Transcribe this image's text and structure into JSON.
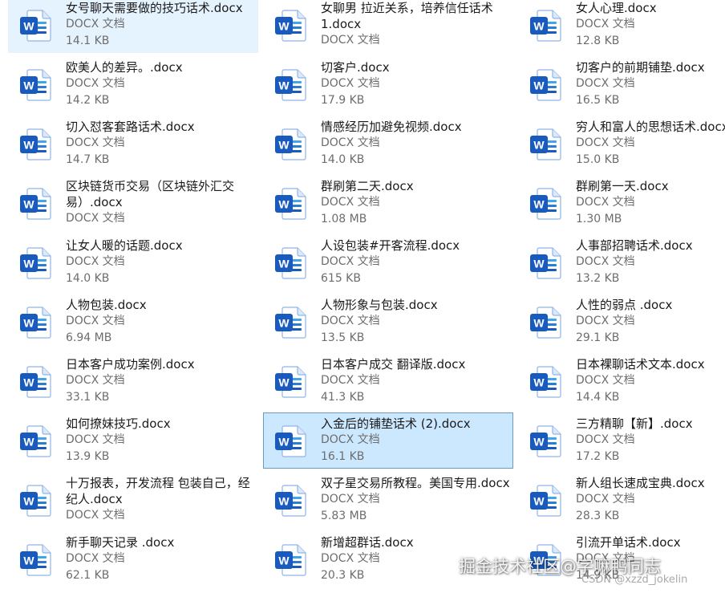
{
  "colors": {
    "word_blue": "#185abd",
    "word_light": "#41a5ee",
    "selected_bg": "#cce8ff",
    "hover_bg": "#e5f3ff"
  },
  "icon_name": "word-document-icon",
  "files": [
    {
      "name": "女号聊天需要做的技巧话术.docx",
      "type": "DOCX 文档",
      "size": "14.1 KB",
      "state": "hover"
    },
    {
      "name": "女聊男 拉近关系，培养信任话术 1.docx",
      "type": "DOCX 文档",
      "size": "",
      "state": ""
    },
    {
      "name": "女人心理.docx",
      "type": "DOCX 文档",
      "size": "12.8 KB",
      "state": ""
    },
    {
      "name": "欧美人的差异。.docx",
      "type": "DOCX 文档",
      "size": "14.2 KB",
      "state": ""
    },
    {
      "name": "切客户.docx",
      "type": "DOCX 文档",
      "size": "17.9 KB",
      "state": ""
    },
    {
      "name": "切客户的前期铺垫.docx",
      "type": "DOCX 文档",
      "size": "16.5 KB",
      "state": ""
    },
    {
      "name": "切入怼客套路话术.docx",
      "type": "DOCX 文档",
      "size": "14.7 KB",
      "state": ""
    },
    {
      "name": "情感经历加避免视频.docx",
      "type": "DOCX 文档",
      "size": "14.0 KB",
      "state": ""
    },
    {
      "name": "穷人和富人的思想话术.docx",
      "type": "DOCX 文档",
      "size": "15.0 KB",
      "state": ""
    },
    {
      "name": "区块链货币交易（区块链外汇交易）.docx",
      "type": "DOCX 文档",
      "size": "",
      "state": ""
    },
    {
      "name": "群刷第二天.docx",
      "type": "DOCX 文档",
      "size": "1.08 MB",
      "state": ""
    },
    {
      "name": "群刷第一天.docx",
      "type": "DOCX 文档",
      "size": "1.30 MB",
      "state": ""
    },
    {
      "name": "让女人暖的话题.docx",
      "type": "DOCX 文档",
      "size": "14.0 KB",
      "state": ""
    },
    {
      "name": "人设包装#开客流程.docx",
      "type": "DOCX 文档",
      "size": "615 KB",
      "state": ""
    },
    {
      "name": "人事部招聘话术.docx",
      "type": "DOCX 文档",
      "size": "13.2 KB",
      "state": ""
    },
    {
      "name": "人物包装.docx",
      "type": "DOCX 文档",
      "size": "6.94 MB",
      "state": ""
    },
    {
      "name": "人物形象与包装.docx",
      "type": "DOCX 文档",
      "size": "13.5 KB",
      "state": ""
    },
    {
      "name": "人性的弱点 .docx",
      "type": "DOCX 文档",
      "size": "29.1 KB",
      "state": ""
    },
    {
      "name": "日本客户成功案例.docx",
      "type": "DOCX 文档",
      "size": "33.1 KB",
      "state": ""
    },
    {
      "name": "日本客户成交 翻译版.docx",
      "type": "DOCX 文档",
      "size": "41.3 KB",
      "state": ""
    },
    {
      "name": "日本裸聊话术文本.docx",
      "type": "DOCX 文档",
      "size": "14.4 KB",
      "state": ""
    },
    {
      "name": "如何撩妹技巧.docx",
      "type": "DOCX 文档",
      "size": "13.9 KB",
      "state": ""
    },
    {
      "name": "入金后的铺垫话术 (2).docx",
      "type": "DOCX 文档",
      "size": "16.1 KB",
      "state": "selected"
    },
    {
      "name": "三方精聊【新】.docx",
      "type": "DOCX 文档",
      "size": "17.2 KB",
      "state": ""
    },
    {
      "name": "十万报表，开发流程 包装自己，经纪人.docx",
      "type": "DOCX 文档",
      "size": "",
      "state": ""
    },
    {
      "name": "双子星交易所教程。美国专用.docx",
      "type": "DOCX 文档",
      "size": "5.83 MB",
      "state": ""
    },
    {
      "name": "新人组长速成宝典.docx",
      "type": "DOCX 文档",
      "size": "28.3 KB",
      "state": ""
    },
    {
      "name": "新手聊天记录 .docx",
      "type": "DOCX 文档",
      "size": "62.1 KB",
      "state": ""
    },
    {
      "name": "新增超群话.docx",
      "type": "DOCX 文档",
      "size": "20.3 KB",
      "state": ""
    },
    {
      "name": "引流开单话术.docx",
      "type": "DOCX 文档",
      "size": "14.9 KB",
      "state": ""
    }
  ],
  "watermark": {
    "main": "掘金技术社区@字嘛鸭同志",
    "csdn": "CSDN @xzzd_jokelin"
  }
}
